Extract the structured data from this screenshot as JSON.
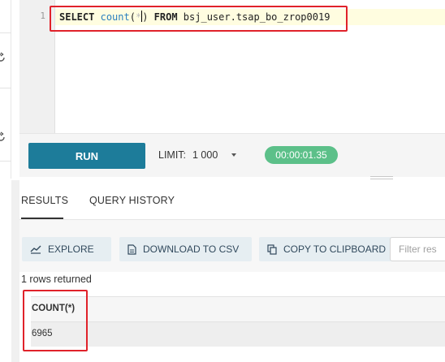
{
  "editor": {
    "line_number": "1",
    "sql": {
      "select": "SELECT",
      "fn": "count",
      "open_paren": "(",
      "star": "*",
      "close_paren": ")",
      "from": "FROM",
      "table": "bsj_user.tsap_bo_zrop0019"
    }
  },
  "run_bar": {
    "run_label": "RUN",
    "limit_label": "LIMIT:",
    "limit_value": "1 000",
    "elapsed": "00:00:01.35"
  },
  "results": {
    "tabs": [
      {
        "label": "RESULTS",
        "active": true
      },
      {
        "label": "QUERY HISTORY",
        "active": false
      }
    ],
    "toolbar": {
      "explore_label": "EXPLORE",
      "download_label": "DOWNLOAD TO CSV",
      "copy_label": "COPY TO CLIPBOARD",
      "filter_placeholder": "Filter res"
    },
    "rows_returned": "1 rows returned",
    "columns": [
      "COUNT(*)"
    ],
    "rows": [
      [
        "6965"
      ]
    ]
  },
  "colors": {
    "run_button": "#1d7c9a",
    "timer_badge": "#5cc089",
    "highlight_annotation": "#e0222a"
  }
}
